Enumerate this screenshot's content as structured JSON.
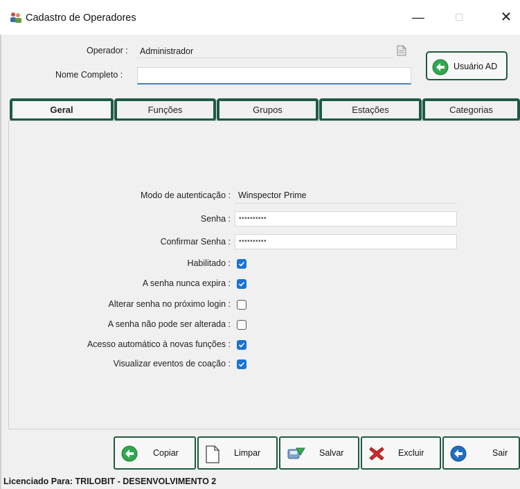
{
  "window": {
    "title": "Cadastro de Operadores",
    "controls": {
      "minimize": "—",
      "maximize": "☐",
      "close": "✕"
    }
  },
  "header": {
    "operador_label": "Operador :",
    "operador_value": "Administrador",
    "nome_label": "Nome Completo :",
    "nome_value": "",
    "ad_button_label": "Usuário AD"
  },
  "tabs": [
    {
      "label": "Geral",
      "active": true
    },
    {
      "label": "Funções",
      "active": false
    },
    {
      "label": "Grupos",
      "active": false
    },
    {
      "label": "Estações",
      "active": false
    },
    {
      "label": "Categorias",
      "active": false
    }
  ],
  "form": {
    "auth_label": "Modo de autenticação :",
    "auth_value": "Winspector Prime",
    "senha_label": "Senha :",
    "senha_value": "••••••••••",
    "confirmar_label": "Confirmar Senha :",
    "confirmar_value": "••••••••••",
    "checkboxes": [
      {
        "label": "Habilitado :",
        "checked": true
      },
      {
        "label": "A senha nunca expira :",
        "checked": true
      },
      {
        "label": "Alterar senha no próximo login :",
        "checked": false
      },
      {
        "label": "A senha não pode ser alterada :",
        "checked": false
      },
      {
        "label": "Acesso automático à novas funções :",
        "checked": true
      },
      {
        "label": "Visualizar eventos de coação :",
        "checked": true
      }
    ]
  },
  "actions": {
    "copiar": "Copiar",
    "limpar": "Limpar",
    "salvar": "Salvar",
    "excluir": "Excluir",
    "sair": "Sair"
  },
  "footer": {
    "license": "Licenciado Para: TRILOBIT - DESENVOLVIMENTO 2"
  },
  "colors": {
    "highlight_border": "#1e5a47",
    "checkbox_on": "#1873d3",
    "input_focus_underline": "#4a7fbf",
    "icon_green": "#2fa84f",
    "icon_blue": "#1f6fc0",
    "icon_red": "#d42a2a"
  }
}
